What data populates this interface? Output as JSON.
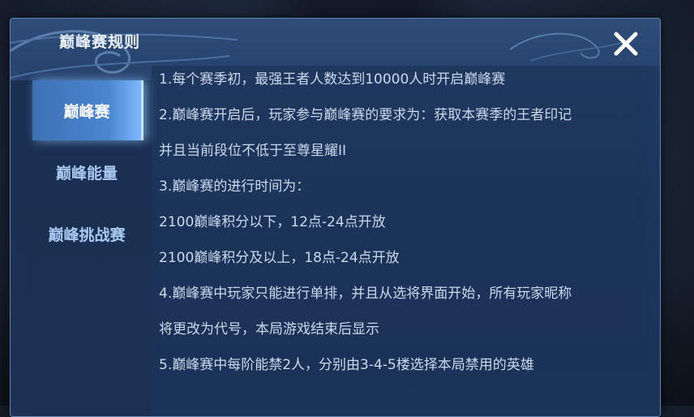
{
  "dialog": {
    "title": "巅峰赛规则"
  },
  "sidebar": {
    "items": [
      {
        "label": "巅峰赛",
        "active": true
      },
      {
        "label": "巅峰能量",
        "active": false
      },
      {
        "label": "巅峰挑战赛",
        "active": false
      }
    ]
  },
  "rules": {
    "lines": [
      "1.每个赛季初，最强王者人数达到10000人时开启巅峰赛",
      "2.巅峰赛开启后，玩家参与巅峰赛的要求为：获取本赛季的王者印记",
      "并且当前段位不低于至尊星耀II",
      "3.巅峰赛的进行时间为：",
      "2100巅峰积分以下，12点-24点开放",
      "2100巅峰积分及以上，18点-24点开放",
      "4.巅峰赛中玩家只能进行单排，并且从选将界面开始，所有玩家昵称",
      "将更改为代号，本局游戏结束后显示",
      "5.巅峰赛中每阶能禁2人，分别由3-4-5楼选择本局禁用的英雄"
    ]
  },
  "colors": {
    "accent": "#4a86cf",
    "panel": "#213a60",
    "text": "#c9d9ee"
  },
  "icons": {
    "close": "close-icon"
  }
}
